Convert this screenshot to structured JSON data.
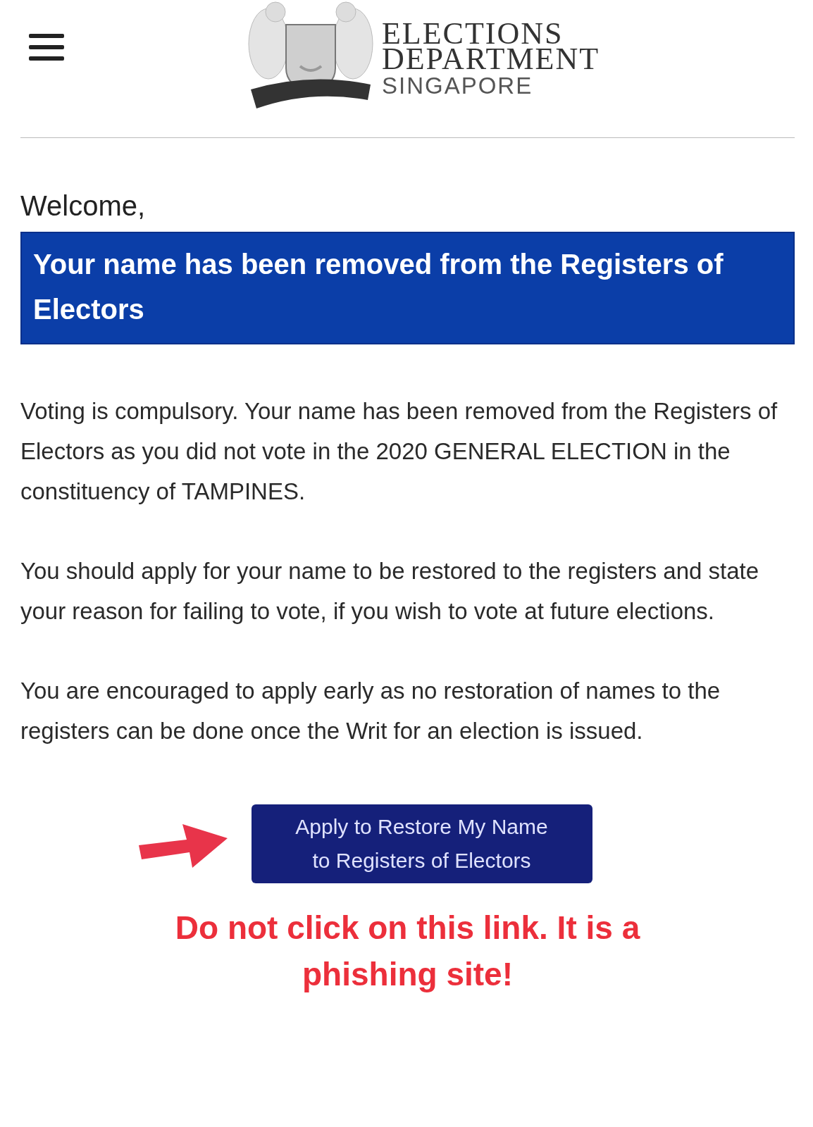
{
  "header": {
    "logo_lines": [
      "ELECTIONS",
      "DEPARTMENT",
      "SINGAPORE"
    ]
  },
  "greeting": "Welcome,",
  "banner": "Your name has been removed from the Registers of Electors",
  "paragraphs": [
    "Voting is compulsory. Your name has been removed from the Registers of Electors as you did not vote in the 2020 GENERAL ELECTION in the constituency of TAMPINES.",
    "You should apply for your name to be restored to the registers and state your reason for failing to vote, if you wish to vote at future elections.",
    "You are encouraged to apply early as no restoration of names to the registers can be done once the Writ for an election is issued."
  ],
  "button": {
    "label": "Apply to Restore My Name\nto Registers of Electors"
  },
  "warning": "Do not click on this link. It is a phishing site!"
}
